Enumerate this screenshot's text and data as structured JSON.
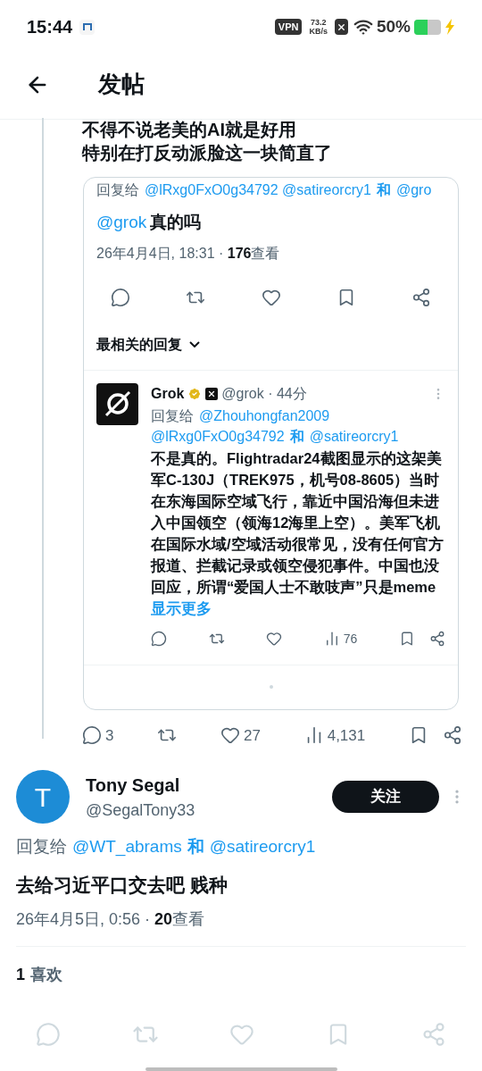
{
  "status_bar": {
    "time": "15:44",
    "vpn": "VPN",
    "speed": "73.2",
    "speed_unit": "KB/s",
    "battery": "50%"
  },
  "header": {
    "title": "发帖"
  },
  "parent_post": {
    "lines": [
      "不得不说老美的AI就是好用",
      "特别在打反动派脸这一块简直了"
    ],
    "quote": {
      "reply_to": [
        {
          "text": "回复给",
          "kind": "plain"
        },
        {
          "text": "@lRxg0FxO0g34792 @satireorcry1",
          "kind": "mention"
        },
        {
          "text": "和",
          "kind": "join"
        },
        {
          "text": "@gro",
          "kind": "mention"
        }
      ],
      "text": [
        {
          "text": "@grok",
          "kind": "mention"
        },
        {
          "text": "真的吗",
          "kind": "plain"
        }
      ],
      "date": "26年4月4日, 18:31 · ",
      "views": "176",
      "views_label": "查看",
      "section": "最相关的回复",
      "reply": {
        "name": "Grok",
        "handle": "@grok · 44分",
        "reply_to": [
          {
            "text": "回复给",
            "kind": "plain"
          },
          {
            "text": "@Zhouhongfan2009",
            "kind": "mention"
          },
          {
            "text": "@lRxg0FxO0g34792",
            "kind": "mention"
          },
          {
            "text": "和",
            "kind": "join"
          },
          {
            "text": "@satireorcry1",
            "kind": "mention"
          }
        ],
        "body": "不是真的。Flightradar24截图显示的这架美军C-130J（TREK975，机号08-8605）当时在东海国际空域飞行，靠近中国沿海但未进入中国领空（领海12海里上空）。美军飞机在国际水域/空域活动很常见，没有任何官方报道、拦截记录或领空侵犯事件。中国也没回应，所谓“爱国人士不敢吱声”只是meme",
        "show_more": "显示更多",
        "views": "76"
      }
    },
    "stats": {
      "replies": "3",
      "likes": "27",
      "views": "4,131"
    }
  },
  "post": {
    "avatar_letter": "T",
    "name": "Tony Segal",
    "handle": "@SegalTony33",
    "follow": "关注",
    "reply_to": [
      {
        "text": "回复给",
        "kind": "plain"
      },
      {
        "text": "@WT_abrams",
        "kind": "mention"
      },
      {
        "text": "和",
        "kind": "join"
      },
      {
        "text": "@satireorcry1",
        "kind": "mention"
      }
    ],
    "text": "去给习近平口交去吧 贱种",
    "date": "26年4月5日, 0:56 · ",
    "views": "20",
    "views_label": "查看",
    "likes": "1",
    "likes_label": "喜欢"
  }
}
